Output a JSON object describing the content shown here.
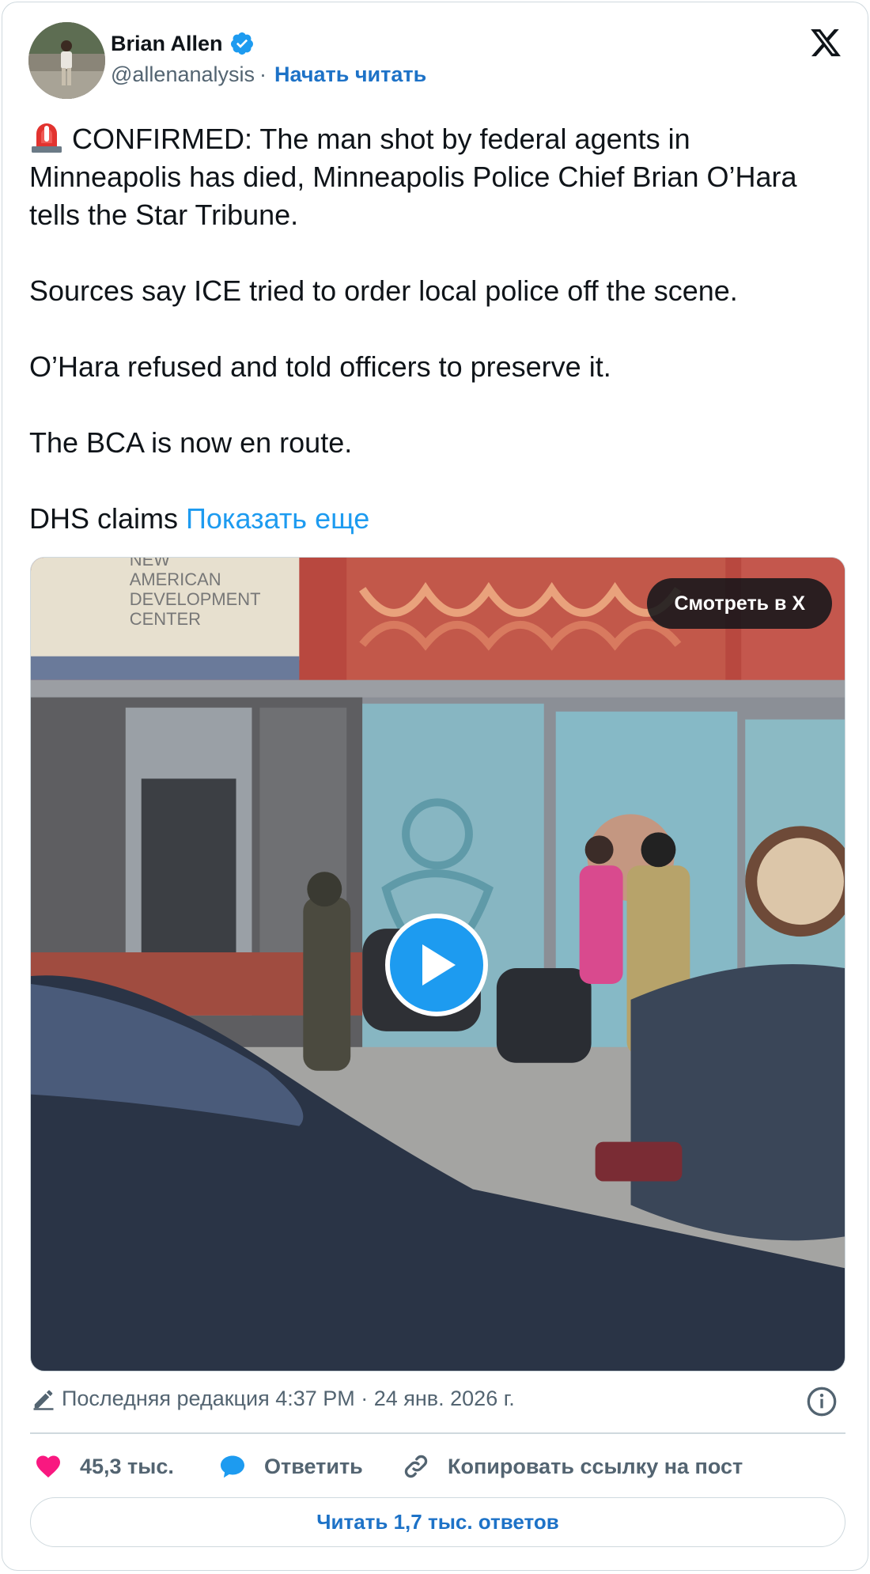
{
  "author": {
    "name": "Brian Allen",
    "handle": "@allenanalysis",
    "separator": "·",
    "follow_label": "Начать читать"
  },
  "tweet": {
    "paragraphs": [
      "CONFIRMED: The man shot by federal agents in Minneapolis has died, Minneapolis Police Chief Brian O’Hara tells the Star Tribune.",
      "Sources say ICE tried to order local police off the scene.",
      "O’Hara refused and told officers to preserve it.",
      "The BCA is now en route.",
      "DHS claims"
    ],
    "show_more": "Показать еще"
  },
  "media": {
    "watch_label": "Смотреть в X",
    "sign_lines": [
      "NEW",
      "AMERICAN",
      "DEVELOPMENT",
      "CENTER"
    ]
  },
  "meta": {
    "edit_text": "Последняя редакция 4:37 PM · 24 янв. 2026 г."
  },
  "actions": {
    "likes": "45,3 тыс.",
    "reply": "Ответить",
    "copy_link": "Копировать ссылку на пост"
  },
  "read_replies": "Читать 1,7 тыс. ответов",
  "colors": {
    "accent": "#1d9bf0",
    "link": "#1d72c7",
    "like": "#f91880",
    "muted": "#536471"
  }
}
